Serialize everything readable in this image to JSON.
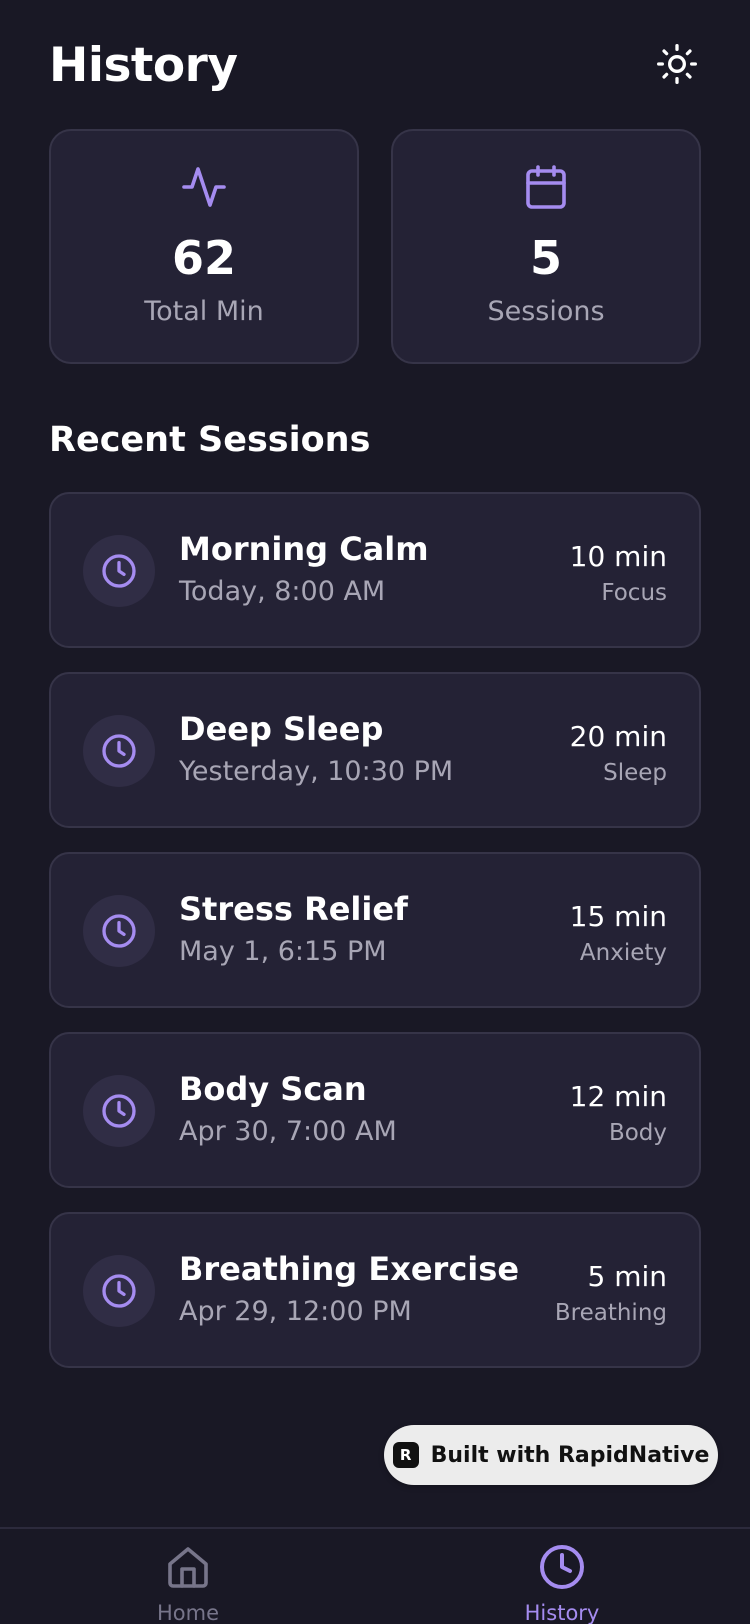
{
  "header": {
    "title": "History",
    "theme_icon": "sun-icon"
  },
  "stats": [
    {
      "icon": "activity-icon",
      "value": "62",
      "label": "Total Min"
    },
    {
      "icon": "calendar-icon",
      "value": "5",
      "label": "Sessions"
    }
  ],
  "recent": {
    "title": "Recent Sessions",
    "items": [
      {
        "name": "Morning Calm",
        "date": "Today, 8:00 AM",
        "duration": "10 min",
        "category": "Focus",
        "icon": "clock-icon"
      },
      {
        "name": "Deep Sleep",
        "date": "Yesterday, 10:30 PM",
        "duration": "20 min",
        "category": "Sleep",
        "icon": "clock-icon"
      },
      {
        "name": "Stress Relief",
        "date": "May 1, 6:15 PM",
        "duration": "15 min",
        "category": "Anxiety",
        "icon": "clock-icon"
      },
      {
        "name": "Body Scan",
        "date": "Apr 30, 7:00 AM",
        "duration": "12 min",
        "category": "Body",
        "icon": "clock-icon"
      },
      {
        "name": "Breathing Exercise",
        "date": "Apr 29, 12:00 PM",
        "duration": "5 min",
        "category": "Breathing",
        "icon": "clock-icon"
      }
    ]
  },
  "badge": {
    "text": "Built with RapidNative",
    "icon": "rapidnative-logo"
  },
  "tabs": [
    {
      "label": "Home",
      "icon": "home-icon",
      "active": false
    },
    {
      "label": "History",
      "icon": "clock-icon",
      "active": true
    }
  ],
  "colors": {
    "background": "#191825",
    "card": "#242235",
    "accent": "#a58cf0",
    "muted_text": "#a8a6b5"
  }
}
